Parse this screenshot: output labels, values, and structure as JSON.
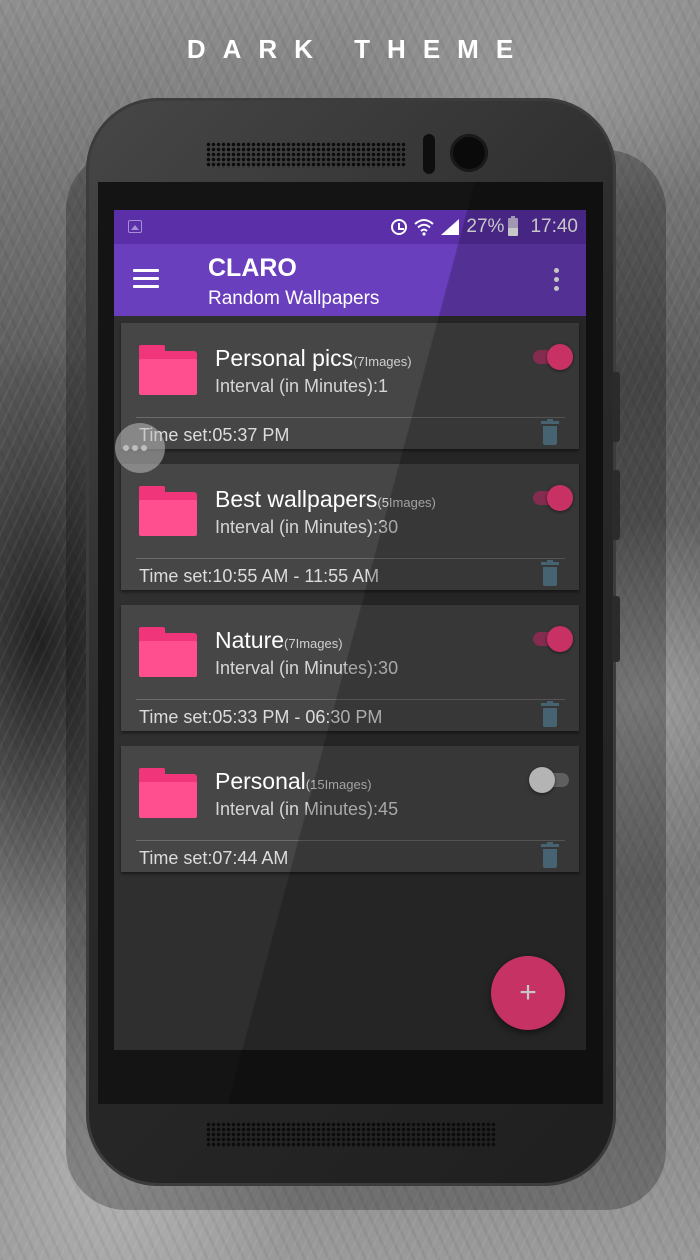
{
  "headline": "DARK THEME",
  "status_bar": {
    "battery": "27%",
    "time": "17:40",
    "icons": [
      "image-icon",
      "alarm-icon",
      "wifi-icon",
      "signal-icon",
      "battery-icon"
    ]
  },
  "app_bar": {
    "title": "CLARO",
    "subtitle": "Random Wallpapers",
    "icons": [
      "menu-icon",
      "overflow-menu-icon"
    ]
  },
  "cards": [
    {
      "name": "Personal pics",
      "count": "(7Images)",
      "interval": "Interval (in Minutes):1",
      "time": "Time set:05:37 PM",
      "enabled": true
    },
    {
      "name": "Best wallpapers",
      "count": "(5Images)",
      "interval": "Interval (in Minutes):30",
      "time": "Time set:10:55 AM - 11:55 AM",
      "enabled": true
    },
    {
      "name": "Nature",
      "count": "(7Images)",
      "interval": "Interval (in Minutes):30",
      "time": "Time set:05:33 PM - 06:30 PM",
      "enabled": true
    },
    {
      "name": "Personal",
      "count": "(15Images)",
      "interval": "Interval (in Minutes):45",
      "time": "Time set:07:44 AM",
      "enabled": false
    }
  ],
  "fab": {
    "label": "+"
  },
  "colors": {
    "status_bar": "#5a2fa8",
    "app_bar": "#6a3fbe",
    "accent": "#ff4081",
    "folder": "#ff4f8e",
    "card": "#464646",
    "background": "#2f2f2f",
    "trash": "#5a7f92"
  }
}
